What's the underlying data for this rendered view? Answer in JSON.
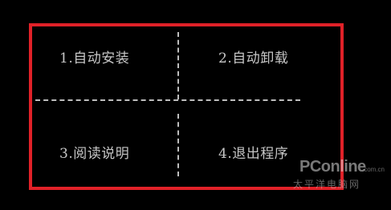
{
  "menu": {
    "items": [
      {
        "label": "1.自动安装"
      },
      {
        "label": "2.自动卸载"
      },
      {
        "label": "3.阅读说明"
      },
      {
        "label": "4.退出程序"
      }
    ]
  },
  "watermark": {
    "brand": "PConline",
    "domain": ".com.cn",
    "subtitle": "太平洋电脑网"
  },
  "colors": {
    "background": "#000000",
    "frame": "#e02128",
    "text": "#c6c6c6",
    "divider": "#bdbdbd"
  }
}
